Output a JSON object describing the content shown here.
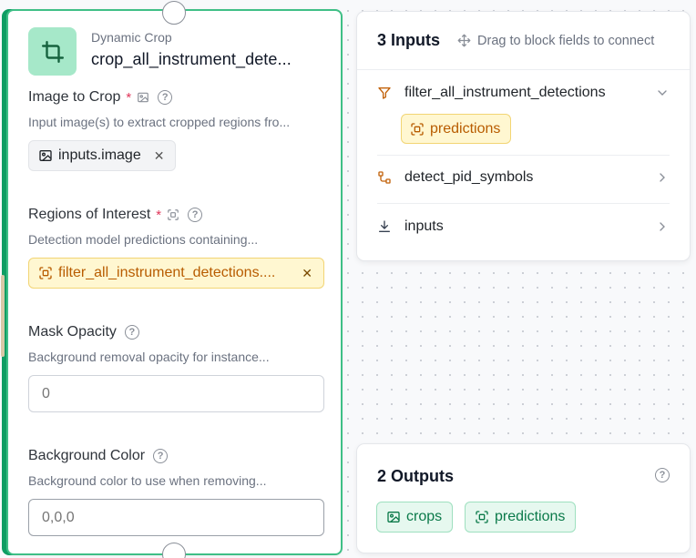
{
  "block": {
    "type": "Dynamic Crop",
    "name": "crop_all_instrument_dete...",
    "fields": [
      {
        "label": "Image to Crop",
        "required": "*",
        "description": "Input image(s) to extract cropped regions fro...",
        "chip": "inputs.image"
      },
      {
        "label": "Regions of Interest",
        "required": "*",
        "description": "Detection model predictions containing...",
        "chip": "filter_all_instrument_detections...."
      },
      {
        "label": "Mask Opacity",
        "description": "Background removal opacity for instance...",
        "placeholder": "0"
      },
      {
        "label": "Background Color",
        "description": "Background color to use when removing...",
        "placeholder": "0,0,0"
      }
    ]
  },
  "inputs_panel": {
    "title": "3 Inputs",
    "hint": "Drag to block fields to connect",
    "rows": [
      {
        "label": "filter_all_instrument_detections",
        "icon": "filter-icon",
        "expanded": true,
        "chips": [
          "predictions"
        ]
      },
      {
        "label": "detect_pid_symbols",
        "icon": "workflow-node-icon",
        "expanded": false
      },
      {
        "label": "inputs",
        "icon": "download-icon",
        "expanded": false
      }
    ]
  },
  "outputs_panel": {
    "title": "2 Outputs",
    "chips": [
      {
        "label": "crops",
        "icon": "image-icon"
      },
      {
        "label": "predictions",
        "icon": "detection-icon"
      }
    ]
  },
  "colors": {
    "accent_green": "#3fbf86",
    "chip_yellow_bg": "#fff7d1",
    "chip_yellow_text": "#b85c00",
    "chip_green_bg": "#e6f8ef",
    "required_red": "#e0365a"
  }
}
